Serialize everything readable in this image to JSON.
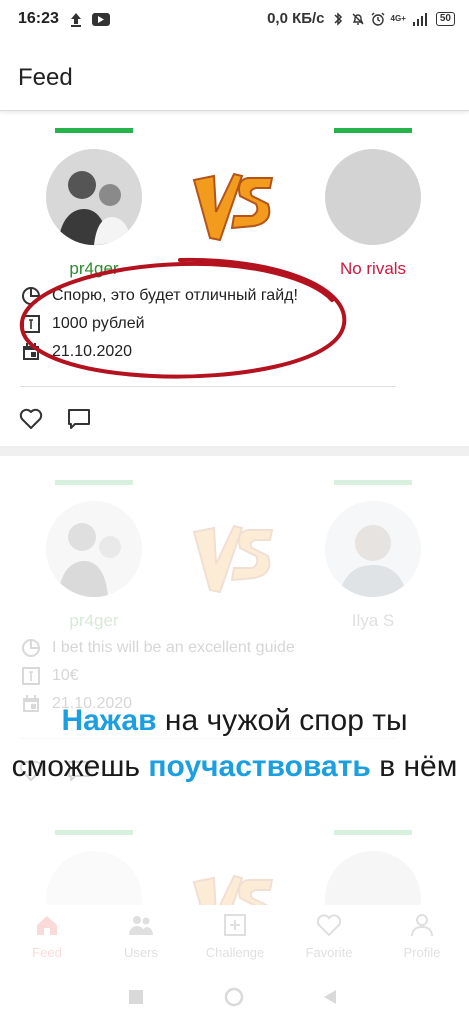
{
  "status_bar": {
    "time": "16:23",
    "net_speed": "0,0 КБ/с",
    "network": "4G+",
    "battery": "50"
  },
  "app_bar": {
    "title": "Feed"
  },
  "cards": [
    {
      "left_user": "pr4ger",
      "right_user": "No rivals",
      "description": "Спорю, это будет отличный гайд!",
      "amount": "1000 рублей",
      "date": "21.10.2020"
    },
    {
      "left_user": "pr4ger",
      "right_user": "Ilya S",
      "description": "I bet this will be an excellent guide",
      "amount": "10€",
      "date": "21.10.2020"
    }
  ],
  "overlay": {
    "line1_highlight": "Нажав",
    "line1_rest": " на чужой спор ты",
    "line2_start": "сможешь ",
    "line2_highlight": "поучаствовать",
    "line2_end": " в нём"
  },
  "bottom_nav": [
    {
      "label": "Feed",
      "icon": "home-icon"
    },
    {
      "label": "Users",
      "icon": "users-icon"
    },
    {
      "label": "Challenge",
      "icon": "add-box-icon"
    },
    {
      "label": "Favorite",
      "icon": "heart-icon"
    },
    {
      "label": "Profile",
      "icon": "person-icon"
    }
  ],
  "colors": {
    "accent_green": "#27b34c",
    "username_green": "#2e8b2e",
    "no_rivals_red": "#d0193f",
    "highlight_blue": "#1b9fe0",
    "annotation_red": "#b3121e"
  }
}
